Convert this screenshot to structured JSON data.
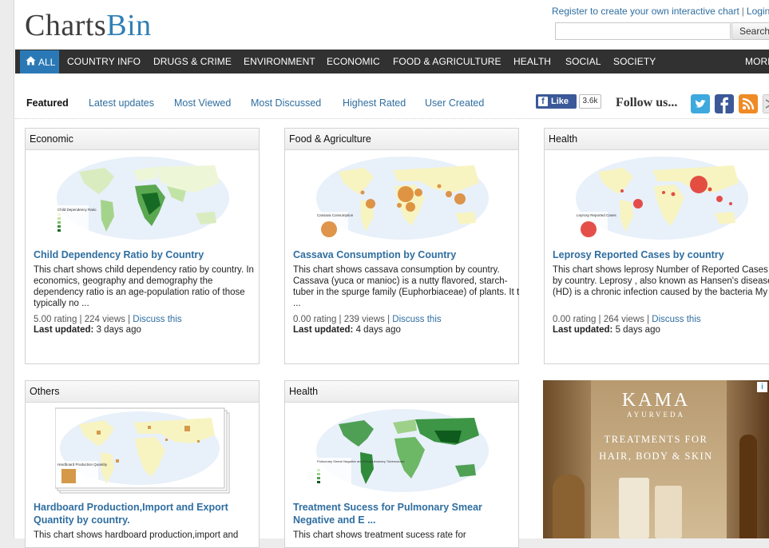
{
  "header": {
    "logo_part1": "Charts",
    "logo_part2": "Bin",
    "register_link": "Register to create your own interactive chart",
    "separator": "|",
    "login_link": "Login",
    "search_button": "Search"
  },
  "nav": {
    "all_label": "ALL",
    "items": [
      "COUNTRY INFO",
      "DRUGS & CRIME",
      "ENVIRONMENT",
      "ECONOMIC",
      "FOOD & AGRICULTURE",
      "HEALTH",
      "SOCIAL",
      "SOCIETY",
      "MORE"
    ]
  },
  "tabs": [
    "Featured",
    "Latest updates",
    "Most Viewed",
    "Most Discussed",
    "Highest Rated",
    "User Created"
  ],
  "social": {
    "fb_like": "Like",
    "fb_count": "3.6k",
    "follow_text": "Follow us...",
    "icons": [
      "twitter-icon",
      "facebook-icon",
      "rss-icon",
      "email-icon"
    ]
  },
  "cards": [
    {
      "category": "Economic",
      "title": "Child Dependency Ratio by Country",
      "desc": "This chart shows child dependency ratio by country. In economics, geography and demography the dependency ratio is an age-population ratio of those typically no ...",
      "rating": "5.00 rating",
      "views": "224 views",
      "discuss": "Discuss this",
      "updated_label": "Last updated:",
      "updated_value": "3 days ago",
      "legend_title": "Child Dependency Ratio"
    },
    {
      "category": "Food & Agriculture",
      "title": "Cassava Consumption by Country",
      "desc": "This chart shows cassava consumption by country. Cassava (yuca or manioc) is a nutty flavored, starch-tuber in the spurge family (Euphorbiaceae) of plants. It t ...",
      "rating": "0.00 rating",
      "views": "239 views",
      "discuss": "Discuss this",
      "updated_label": "Last updated:",
      "updated_value": "4 days ago",
      "legend_title": "Cassava Consumption"
    },
    {
      "category": "Health",
      "title": "Leprosy Reported Cases by country",
      "desc": "This chart shows leprosy Number of Reported Cases by country. Leprosy , also known as Hansen's disease (HD) is a chronic infection caused by the bacteria My ...",
      "rating": "0.00 rating",
      "views": "264 views",
      "discuss": "Discuss this",
      "updated_label": "Last updated:",
      "updated_value": "5 days ago",
      "legend_title": "Leprosy Reported Cases"
    },
    {
      "category": "Others",
      "title": "Hardboard Production,Import and Export Quantity by country.",
      "desc": "This chart shows hardboard production,import and",
      "legend_title": "Hardboard Production Quantity"
    },
    {
      "category": "Health",
      "title": "Treatment Sucess for Pulmonary Smear Negative and E ...",
      "desc": "This chart shows treatment sucess rate for",
      "legend_title": "Pulmonary Smear Negative and Extrapulmonary Tuberculosis"
    }
  ],
  "ad": {
    "brand": "KAMA",
    "sub": "AYURVEDA",
    "line1": "TREATMENTS FOR",
    "line2": "HAIR, BODY & SKIN"
  },
  "colors": {
    "nav_bg": "#313131",
    "nav_active": "#2a79b6",
    "link": "#2f6ea0",
    "logo_blue": "#2f7fb5"
  }
}
